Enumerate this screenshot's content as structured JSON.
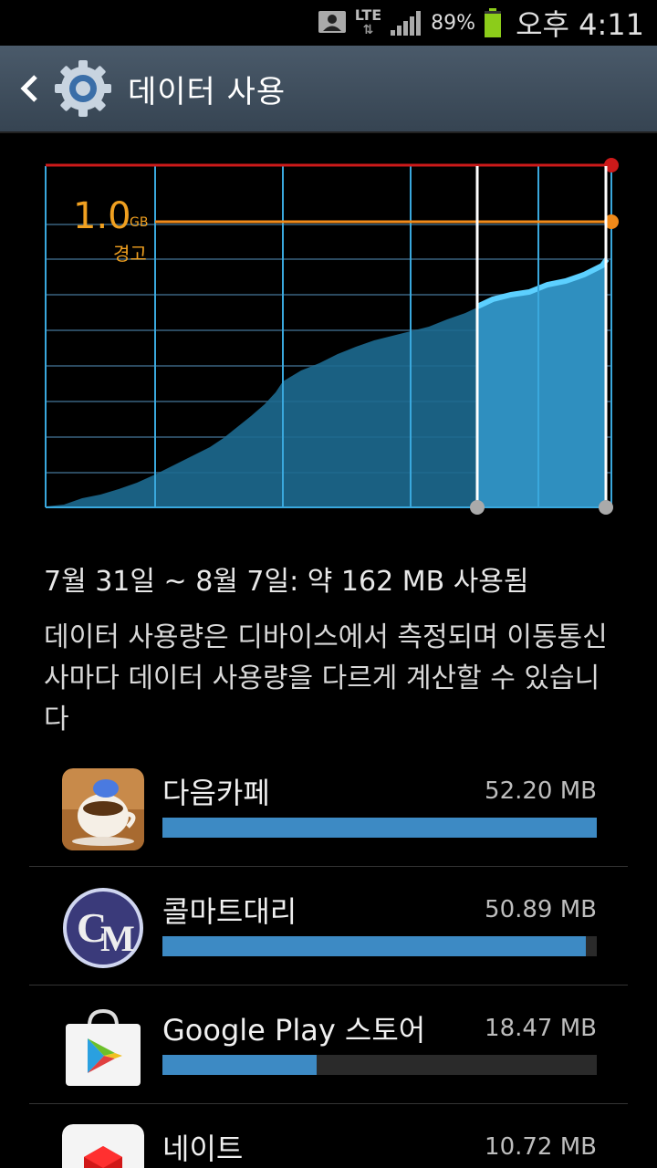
{
  "status_bar": {
    "network": "LTE",
    "battery_pct": "89%",
    "battery_level": 0.89,
    "time": "오후 4:11"
  },
  "header": {
    "title": "데이터 사용"
  },
  "chart": {
    "limit_value": "1.0",
    "limit_unit": "GB",
    "warning_label": "경고"
  },
  "summary": {
    "usage_text": "7월 31일 ~ 8월 7일: 약 162 MB 사용됨",
    "note": "데이터 사용량은 디바이스에서 측정되며 이동통신사마다 데이터 사용량을 다르게 계산할 수 있습니다"
  },
  "apps": [
    {
      "name": "다음카페",
      "size": "52.20 MB",
      "fraction": 1.0
    },
    {
      "name": "콜마트대리",
      "size": "50.89 MB",
      "fraction": 0.975
    },
    {
      "name": "Google Play 스토어",
      "size": "18.47 MB",
      "fraction": 0.354
    },
    {
      "name": "네이트",
      "size": "10.72 MB",
      "fraction": 0.205
    }
  ],
  "colors": {
    "limit_line": "#cc1a1a",
    "warning_line": "#f08a1a",
    "usage_fill": "#2f8fbf",
    "grid": "#3aa8dd"
  }
}
